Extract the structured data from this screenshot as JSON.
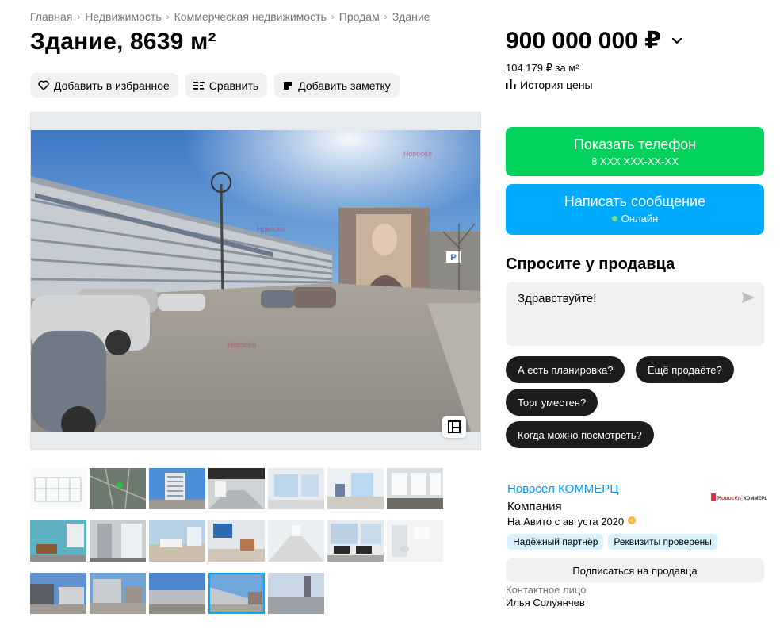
{
  "breadcrumb": [
    "Главная",
    "Недвижимость",
    "Коммерческая недвижимость",
    "Продам",
    "Здание"
  ],
  "title": "Здание, 8639 м²",
  "actions": {
    "favorite": "Добавить в избранное",
    "compare": "Сравнить",
    "note": "Добавить заметку"
  },
  "price": {
    "value": "900 000 000 ₽",
    "per_meter": "104 179 ₽ за м²",
    "history": "История цены"
  },
  "contact_buttons": {
    "phone_label": "Показать телефон",
    "phone_number": "8 XXX XXX-XX-XX",
    "message_label": "Написать сообщение",
    "status": "Онлайн"
  },
  "ask": {
    "title": "Спросите у продавца",
    "message": "Здравствуйте!",
    "quick_questions": [
      "А есть планировка?",
      "Ещё продаёте?",
      "Торг уместен?",
      "Когда можно посмотреть?"
    ]
  },
  "seller": {
    "name": "Новосёл КОММЕРЦ",
    "type": "Компания",
    "since": "На Авито с августа 2020",
    "logo_text": "Новосёл | КОММЕРЦ",
    "badges": [
      "Надёжный партнёр",
      "Реквизиты проверены"
    ],
    "subscribe": "Подписаться на продавца",
    "contact_label": "Контактное лицо",
    "contact_name": "Илья Солуянчев"
  },
  "photo": {
    "watermark": "Новосёл"
  },
  "colors": {
    "green": "#02d15c",
    "blue": "#00aaff",
    "link": "#0099f7",
    "chip": "#1c1c1c",
    "badge": "#d9f1ff"
  }
}
